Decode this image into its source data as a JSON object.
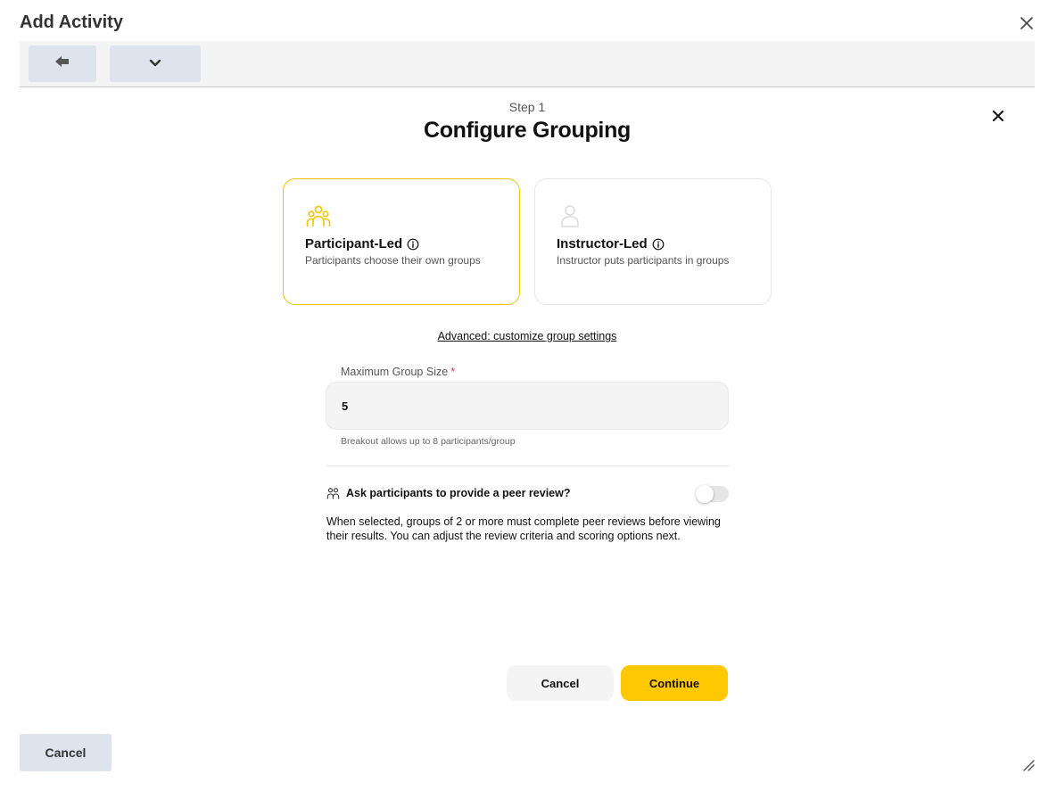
{
  "dialog": {
    "title": "Add Activity",
    "footer_cancel_label": "Cancel"
  },
  "panel": {
    "step_label": "Step 1",
    "title": "Configure Grouping"
  },
  "cards": [
    {
      "title": "Participant-Led",
      "description": "Participants choose their own groups",
      "icon": "group-icon",
      "selected": true
    },
    {
      "title": "Instructor-Led",
      "description": "Instructor puts participants in groups",
      "icon": "user-icon",
      "selected": false
    }
  ],
  "advanced_link": "Advanced: customize group settings",
  "group_size": {
    "label": "Maximum Group Size",
    "required_marker": "*",
    "value": "5",
    "help": "Breakout allows up to 8 participants/group"
  },
  "peer_review": {
    "label": "Ask participants to provide a peer review?",
    "enabled": false,
    "description": "When selected, groups of 2 or more must complete peer reviews before viewing their results. You can adjust the review criteria and scoring options next."
  },
  "actions": {
    "cancel_label": "Cancel",
    "continue_label": "Continue"
  },
  "colors": {
    "accent": "#ffc800",
    "selected_border": "#f5c400",
    "toolbar_button": "#dde4ee",
    "required": "#d63b3b"
  }
}
